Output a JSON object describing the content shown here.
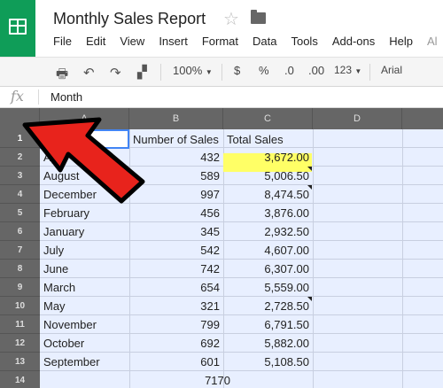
{
  "doc_title": "Monthly Sales Report",
  "icons": {
    "star": "star-icon",
    "folder": "folder-icon",
    "fx": "fx-icon"
  },
  "menu": [
    "File",
    "Edit",
    "View",
    "Insert",
    "Format",
    "Data",
    "Tools",
    "Add-ons",
    "Help",
    "Al"
  ],
  "toolbar": {
    "zoom": "100%",
    "currency": "$",
    "percent": "%",
    "dec_decrease": ".0",
    "dec_increase": ".00",
    "more_formats": "123",
    "font": "Arial"
  },
  "formula_bar": {
    "fx_label": "fx",
    "value": "Month"
  },
  "columns": [
    "A",
    "B",
    "C",
    "D"
  ],
  "row_numbers": [
    "1",
    "2",
    "3",
    "4",
    "5",
    "6",
    "7",
    "8",
    "9",
    "10",
    "11",
    "12",
    "13",
    "14"
  ],
  "headers": {
    "a1": "Month",
    "b1": "Number of Sales",
    "c1": "Total Sales"
  },
  "rows": [
    {
      "month": "April",
      "sales": "432",
      "total": "3,672.00",
      "note": false,
      "highlight": true
    },
    {
      "month": "August",
      "sales": "589",
      "total": "5,006.50",
      "note": true
    },
    {
      "month": "December",
      "sales": "997",
      "total": "8,474.50",
      "note": true
    },
    {
      "month": "February",
      "sales": "456",
      "total": "3,876.00",
      "note": false
    },
    {
      "month": "January",
      "sales": "345",
      "total": "2,932.50",
      "note": false
    },
    {
      "month": "July",
      "sales": "542",
      "total": "4,607.00",
      "note": false
    },
    {
      "month": "June",
      "sales": "742",
      "total": "6,307.00",
      "note": false
    },
    {
      "month": "March",
      "sales": "654",
      "total": "5,559.00",
      "note": false
    },
    {
      "month": "May",
      "sales": "321",
      "total": "2,728.50",
      "note": true
    },
    {
      "month": "November",
      "sales": "799",
      "total": "6,791.50",
      "note": false
    },
    {
      "month": "October",
      "sales": "692",
      "total": "5,882.00",
      "note": false
    },
    {
      "month": "September",
      "sales": "601",
      "total": "5,108.50",
      "note": false
    }
  ],
  "total_row": {
    "sales": "7170"
  },
  "colors": {
    "logo": "#0F9D58",
    "arrow": "#E8231C",
    "highlight": "#FFFF66",
    "selection": "#E8EFFF",
    "header_gray": "#666666"
  }
}
